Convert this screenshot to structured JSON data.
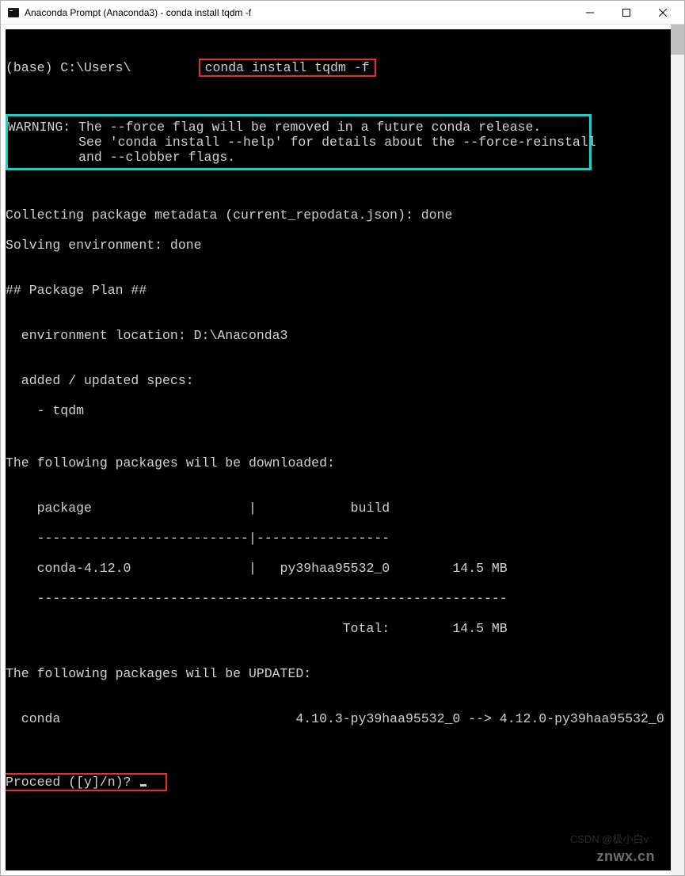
{
  "titlebar": {
    "title": "Anaconda Prompt (Anaconda3) - conda  install tqdm -f"
  },
  "prompt": {
    "prefix": "(base) C:\\Users\\",
    "command": "conda install tqdm -f"
  },
  "warning": {
    "line1": "WARNING: The --force flag will be removed in a future conda release.",
    "line2": "         See 'conda install --help' for details about the --force-reinstall",
    "line3": "         and --clobber flags."
  },
  "status": {
    "collecting": "Collecting package metadata (current_repodata.json): done",
    "solving": "Solving environment: done"
  },
  "plan": {
    "header": "## Package Plan ##",
    "env_location": "  environment location: D:\\Anaconda3",
    "specs_header": "  added / updated specs:",
    "spec1": "    - tqdm"
  },
  "downloads": {
    "header": "The following packages will be downloaded:",
    "col_package": "    package                    |            build",
    "rule1": "    ---------------------------|-----------------",
    "row1": "    conda-4.12.0               |   py39haa95532_0        14.5 MB",
    "rule2": "    ------------------------------------------------------------",
    "total": "                                           Total:        14.5 MB"
  },
  "updates": {
    "header": "The following packages will be UPDATED:",
    "row1": "  conda                              4.10.3-py39haa95532_0 --> 4.12.0-py39haa95532_0"
  },
  "proceed": {
    "prompt": "Proceed ([y]/n)? "
  },
  "watermark": {
    "site": "znwx.cn",
    "credit": "CSDN @极小白v"
  }
}
